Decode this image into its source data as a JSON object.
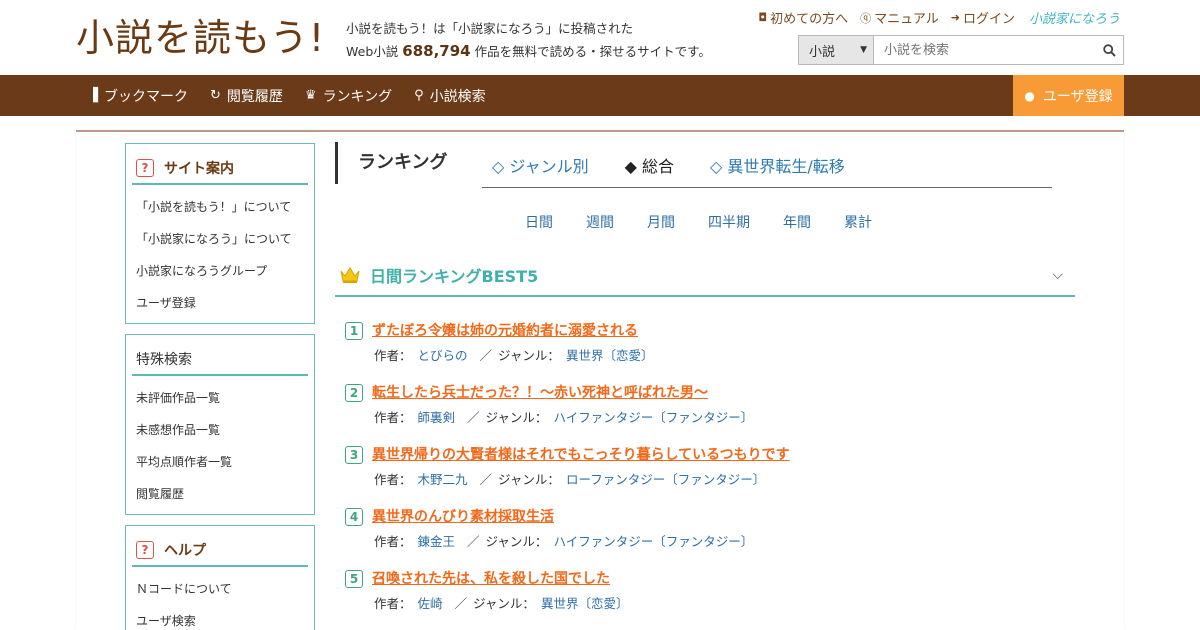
{
  "header": {
    "logo": "小説を読もう!",
    "tagline_line1": "小説を読もう！は「小説家になろう」に投稿された",
    "tagline_prefix": "Web小説",
    "tagline_count": "688,794",
    "tagline_suffix": "作品を無料で読める・探せるサイトです。",
    "links": {
      "first_time": "初めての方へ",
      "manual": "マニュアル",
      "login": "ログイン"
    },
    "brand_mini": "小説家になろう",
    "search": {
      "type_value": "小説",
      "placeholder": "小説を検索"
    }
  },
  "nav": {
    "bookmark": "ブックマーク",
    "history": "閲覧履歴",
    "ranking": "ランキング",
    "search": "小説検索",
    "register": "ユーザ登録"
  },
  "sidebar": {
    "guide": {
      "title": "サイト案内",
      "items": [
        "「小説を読もう！」について",
        "「小説家になろう」について",
        "小説家になろうグループ",
        "ユーザ登録"
      ]
    },
    "special": {
      "title": "特殊検索",
      "items": [
        "未評価作品一覧",
        "未感想作品一覧",
        "平均点順作者一覧",
        "閲覧履歴"
      ]
    },
    "help": {
      "title": "ヘルプ",
      "items": [
        "Ｎコードについて",
        "ユーザ検索"
      ]
    }
  },
  "ranking": {
    "title": "ランキング",
    "tabs": {
      "genre": "◇ ジャンル別",
      "overall": "◆ 総合",
      "isekai": "◇ 異世界転生/転移"
    },
    "periods": [
      "日間",
      "週間",
      "月間",
      "四半期",
      "年間",
      "累計"
    ],
    "section_title": "日間ランキングBEST5",
    "author_label": "作者：",
    "genre_label": "ジャンル：",
    "separator": "／",
    "items": [
      {
        "num": "1",
        "title": "ずたぼろ令嬢は姉の元婚約者に溺愛される",
        "author": "とびらの",
        "genre": "異世界〔恋愛〕"
      },
      {
        "num": "2",
        "title": "転生したら兵士だった？！〜赤い死神と呼ばれた男〜",
        "author": "師裏剣",
        "genre": "ハイファンタジー〔ファンタジー〕"
      },
      {
        "num": "3",
        "title": "異世界帰りの大賢者様はそれでもこっそり暮らしているつもりです",
        "author": "木野二九",
        "genre": "ローファンタジー〔ファンタジー〕"
      },
      {
        "num": "4",
        "title": "異世界のんびり素材採取生活",
        "author": "錬金王",
        "genre": "ハイファンタジー〔ファンタジー〕"
      },
      {
        "num": "5",
        "title": "召喚された先は、私を殺した国でした",
        "author": "佐崎",
        "genre": "異世界〔恋愛〕"
      }
    ]
  },
  "colors": {
    "brown": "#6b3a18",
    "orange": "#f89b36",
    "teal": "#5fb8b3",
    "link_orange": "#f2691a"
  }
}
